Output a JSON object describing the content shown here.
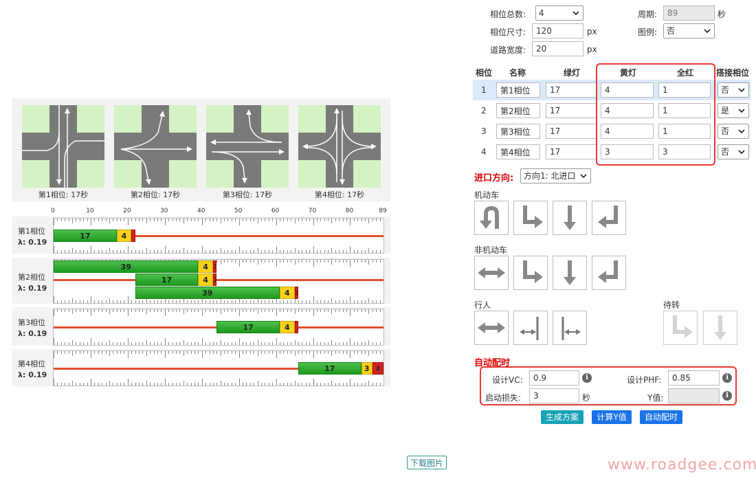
{
  "settings": {
    "phase_count_label": "相位总数:",
    "phase_count_value": "4",
    "cycle_label": "周期:",
    "cycle_value": "89",
    "cycle_unit": "秒",
    "phase_size_label": "相位尺寸:",
    "phase_size_value": "120",
    "phase_size_unit": "px",
    "legend_label": "图例:",
    "legend_value": "否",
    "road_width_label": "道路宽度:",
    "road_width_value": "20",
    "road_width_unit": "px"
  },
  "table": {
    "headers": [
      "相位",
      "名称",
      "绿灯",
      "黄灯",
      "全红",
      "搭接相位"
    ],
    "rows": [
      {
        "num": "1",
        "name": "第1相位",
        "green": "17",
        "yellow": "4",
        "red": "1",
        "overlap": "否"
      },
      {
        "num": "2",
        "name": "第2相位",
        "green": "17",
        "yellow": "4",
        "red": "1",
        "overlap": "是"
      },
      {
        "num": "3",
        "name": "第3相位",
        "green": "17",
        "yellow": "4",
        "red": "1",
        "overlap": "否"
      },
      {
        "num": "4",
        "name": "第4相位",
        "green": "17",
        "yellow": "3",
        "red": "3",
        "overlap": "否"
      }
    ]
  },
  "approach": {
    "label": "进口方向:",
    "value": "方向1: 北进口"
  },
  "movements": {
    "vehicle_title": "机动车",
    "nonmotor_title": "非机动车",
    "pedestrian_title": "行人",
    "waiting_title": "待转"
  },
  "auto_timing": {
    "title": "自动配时",
    "vc_label": "设计VC:",
    "vc_value": "0.9",
    "phf_label": "设计PHF:",
    "phf_value": "0.85",
    "startup_loss_label": "启动损失:",
    "startup_loss_value": "3",
    "startup_loss_unit": "秒",
    "y_label": "Y值:",
    "y_value": "",
    "info_glyph": "i"
  },
  "buttons": {
    "generate": "生成方案",
    "compute_y": "计算Y值",
    "auto_time": "自动配时",
    "download": "下载图片"
  },
  "phase_diagrams": [
    {
      "caption": "第1相位: 17秒"
    },
    {
      "caption": "第2相位: 17秒"
    },
    {
      "caption": "第3相位: 17秒"
    },
    {
      "caption": "第4相位: 17秒"
    }
  ],
  "timeline": {
    "axis_ticks": [
      "0",
      "10",
      "20",
      "30",
      "40",
      "50",
      "60",
      "70",
      "80",
      "89"
    ],
    "cycle": 89,
    "rows": [
      {
        "label": "第1相位",
        "lambda": "λ: 0.19",
        "bars": [
          {
            "start": 0,
            "green": 17,
            "yellow": 4,
            "red": 1,
            "g_text": "17",
            "y_text": "4",
            "r_text": ""
          }
        ],
        "red_line": {
          "start": 22,
          "end": 89
        }
      },
      {
        "label": "第2相位",
        "lambda": "λ: 0.19",
        "bars": [
          {
            "start": 0,
            "green": 39,
            "yellow": 4,
            "red": 1,
            "g_text": "39",
            "y_text": "4",
            "r_text": "1"
          },
          {
            "start": 22,
            "green": 17,
            "yellow": 4,
            "red": 1,
            "g_text": "17",
            "y_text": "4",
            "r_text": "1"
          },
          {
            "start": 22,
            "green": 39,
            "yellow": 4,
            "red": 1,
            "g_text": "39",
            "y_text": "4",
            "r_text": "1"
          }
        ],
        "red_line": {
          "start": 0,
          "end": 89
        }
      },
      {
        "label": "第3相位",
        "lambda": "λ: 0.19",
        "bars": [
          {
            "start": 44,
            "green": 17,
            "yellow": 4,
            "red": 1,
            "g_text": "17",
            "y_text": "4",
            "r_text": ""
          }
        ],
        "red_line": {
          "start": 0,
          "end": 89
        }
      },
      {
        "label": "第4相位",
        "lambda": "λ: 0.19",
        "bars": [
          {
            "start": 66,
            "green": 17,
            "yellow": 3,
            "red": 3,
            "g_text": "17",
            "y_text": "3",
            "r_text": "3"
          }
        ],
        "red_line": {
          "start": 0,
          "end": 66
        }
      }
    ]
  },
  "watermark": "www.roadgee.com",
  "colors": {
    "green": "#2aa82a",
    "yellow": "#f6d21b",
    "red": "#d22222",
    "accent_red": "#e53935",
    "road": "#7a7a7a",
    "grass": "#d4f2c4",
    "teal_button": "#17a2b8",
    "blue_button": "#1a73e8"
  }
}
